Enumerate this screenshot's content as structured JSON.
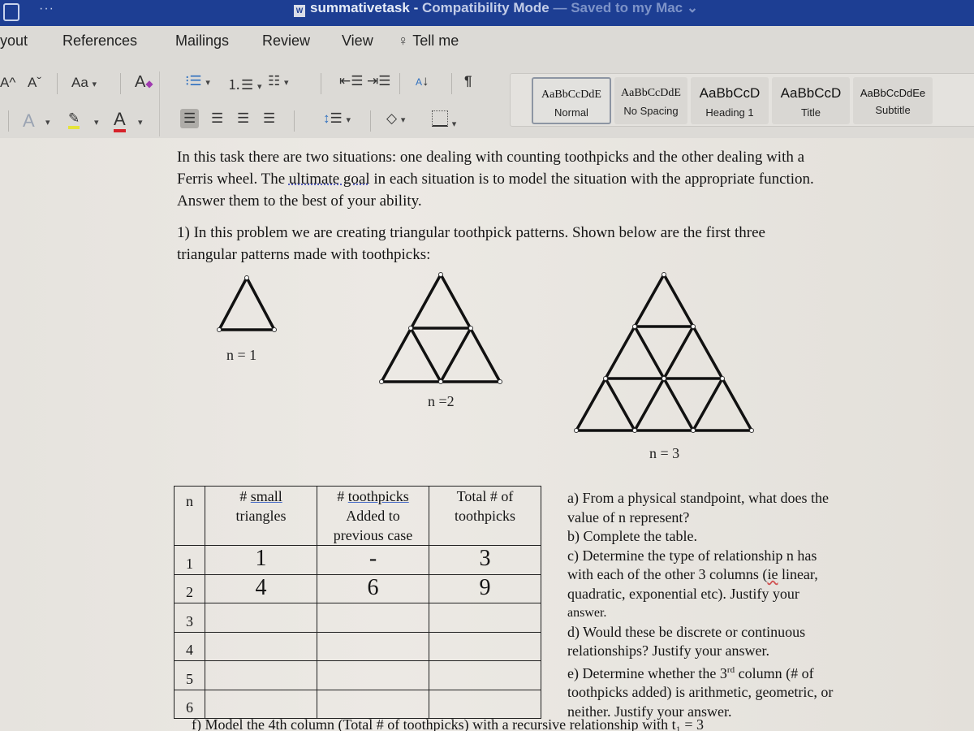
{
  "window": {
    "doc_name": "summativetask",
    "separator": " - ",
    "mode": "Compatibility Mode",
    "saved_status": "— Saved to my Mac",
    "saved_chevron": "⌄"
  },
  "ribbon": {
    "tabs": [
      {
        "label": "yout"
      },
      {
        "label": "References"
      },
      {
        "label": "Mailings"
      },
      {
        "label": "Review"
      },
      {
        "label": "View"
      },
      {
        "label": "Tell me"
      }
    ],
    "font_controls": {
      "grow": "A^",
      "shrink": "Aˇ",
      "change_case": "Aa",
      "clear_format": "A"
    },
    "styles": [
      {
        "sample": "AaBbCcDdE",
        "label": "Normal",
        "selected": true
      },
      {
        "sample": "AaBbCcDdE",
        "label": "No Spacing"
      },
      {
        "sample": "AaBbCcD",
        "label": "Heading 1"
      },
      {
        "sample": "AaBbCcD",
        "label": "Title"
      },
      {
        "sample": "AaBbCcDdEe",
        "label": "Subtitle"
      }
    ],
    "colors": {
      "highlight": "#e5e33a",
      "font_color": "#d6222a",
      "titlebar": "#1d3e93"
    }
  },
  "document": {
    "intro": [
      "In this task there are two situations: one dealing with counting toothpicks and the other dealing with a",
      "Ferris wheel. The ",
      "ultimate goal",
      " in each situation is to model the situation with the appropriate function.",
      "Answer them to the best of your ability."
    ],
    "problem1": [
      "1) In this problem we are creating triangular toothpick patterns. Shown below are the first three",
      "triangular patterns made with toothpicks:"
    ],
    "figure_labels": [
      "n = 1",
      "n =2",
      "n = 3"
    ],
    "table": {
      "headers": [
        [
          "n"
        ],
        [
          "# ",
          "small",
          "triangles"
        ],
        [
          "# ",
          "toothpicks",
          "Added to",
          "previous case"
        ],
        [
          "Total # of",
          "toothpicks"
        ]
      ],
      "rows": [
        {
          "n": "1",
          "small": "1",
          "added": "-",
          "total": "3"
        },
        {
          "n": "2",
          "small": "4",
          "added": "6",
          "total": "9"
        },
        {
          "n": "3",
          "small": "",
          "added": "",
          "total": ""
        },
        {
          "n": "4",
          "small": "",
          "added": "",
          "total": ""
        },
        {
          "n": "5",
          "small": "",
          "added": "",
          "total": ""
        },
        {
          "n": "6",
          "small": "",
          "added": "",
          "total": ""
        }
      ]
    },
    "questions": [
      "a) From a physical standpoint, what does the",
      "value of n represent?",
      "b) Complete the table.",
      "c) Determine the type of relationship n has",
      "with each of the other 3 columns (",
      "ie",
      " linear,",
      "quadratic, exponential etc). Justify your",
      "answer.",
      "d) Would these be discrete or continuous",
      "relationships? Justify your answer.",
      "e) Determine whether the 3",
      "rd",
      " column (# of",
      "toothpicks added) is arithmetic, geometric, or",
      "neither. Justify your answer."
    ],
    "bottom_line": "f) Model the 4th column (Total # of toothpicks) with a recursive relationship with t₁ = 3"
  }
}
